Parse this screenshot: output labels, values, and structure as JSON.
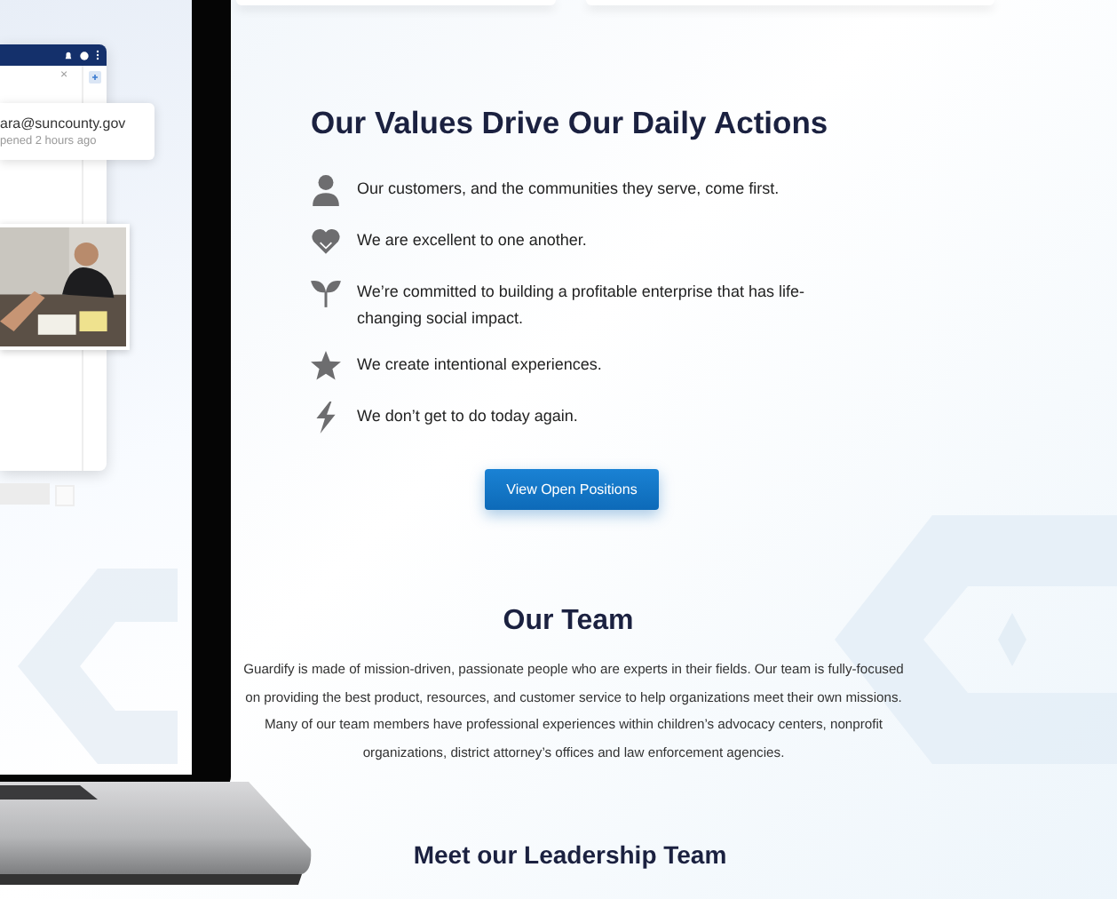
{
  "laptop_screen": {
    "window": {
      "close_button": "×",
      "popup": {
        "email": "ara@suncounty.gov",
        "status": "pened 2 hours ago"
      }
    }
  },
  "values": {
    "heading": "Our Values Drive Our Daily Actions",
    "items": [
      {
        "kind": "person",
        "text": "Our customers, and the communities they serve, come first."
      },
      {
        "kind": "heart",
        "text": "We are excellent to one another."
      },
      {
        "kind": "sprout",
        "text": "We’re committed to building a profitable enterprise that has life-changing social impact."
      },
      {
        "kind": "star",
        "text": "We create intentional experiences."
      },
      {
        "kind": "bolt",
        "text": "We don’t get to do today again."
      }
    ],
    "button": "View Open Positions"
  },
  "team": {
    "heading": "Our Team",
    "text": "Guardify is made of mission-driven, passionate people who are experts in their fields. Our team is fully-focused on providing the best product, resources, and customer service to help organizations meet their own missions. Many of our team members have professional experiences within children’s advocacy centers, nonprofit organizations, district attorney’s offices and law enforcement agencies."
  },
  "leadership": {
    "heading": "Meet our Leadership Team"
  }
}
